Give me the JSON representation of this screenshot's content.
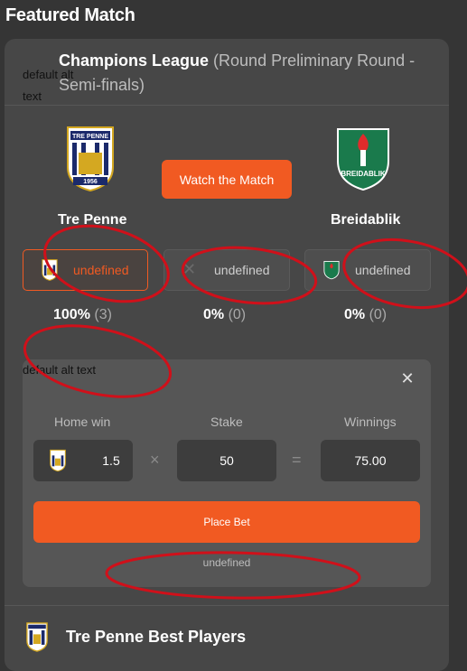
{
  "page": {
    "title": "Featured Match"
  },
  "alt_text": {
    "top": "default alt text",
    "middle": "default alt text"
  },
  "match": {
    "league": "Champions League",
    "round": "(Round Preliminary Round - Semi-finals)",
    "watch_label": "Watch the Match",
    "home": {
      "name": "Tre Penne",
      "crest_year": "1956",
      "crest_banner": "TRE PENNE"
    },
    "away": {
      "name": "Breidablik",
      "crest_banner": "BREIDABLIK"
    }
  },
  "odds": {
    "home_label": "undefined",
    "draw_label": "undefined",
    "away_label": "undefined"
  },
  "percentages": {
    "home": {
      "value": "100%",
      "count": "(3)"
    },
    "draw": {
      "value": "0%",
      "count": "(0)"
    },
    "away": {
      "value": "0%",
      "count": "(0)"
    }
  },
  "betslip": {
    "close_glyph": "✕",
    "home_win_label": "Home win",
    "stake_label": "Stake",
    "winnings_label": "Winnings",
    "odds_value": "1.5",
    "times_glyph": "×",
    "stake_value": "50",
    "equals_glyph": "=",
    "winnings_value": "75.00",
    "place_label": "Place Bet",
    "status": "undefined"
  },
  "players": {
    "title": "Tre Penne Best Players"
  },
  "colors": {
    "accent": "#f15a22",
    "annotation": "#d0101a",
    "card": "#474747",
    "background": "#353535"
  }
}
